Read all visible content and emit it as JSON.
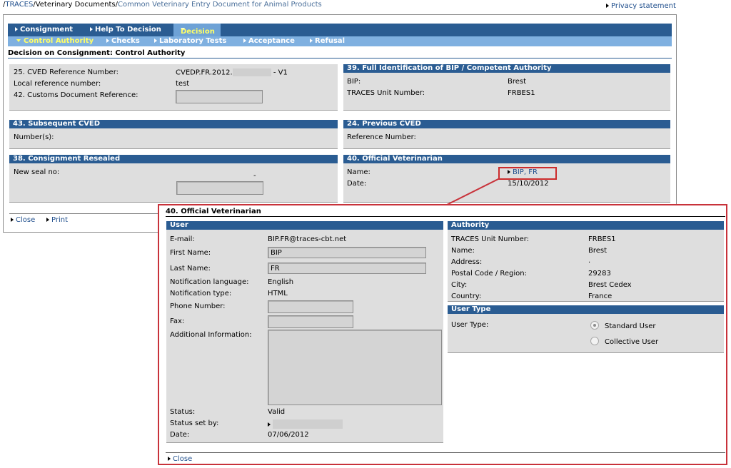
{
  "breadcrumb": {
    "sep": "/",
    "traces": "TRACES",
    "vet_docs": "Veterinary Documents",
    "current": "Common Veterinary Entry Document for Animal Products"
  },
  "privacy": "Privacy statement",
  "nav": {
    "top": [
      "Consignment",
      "Help To Decision",
      "Decision"
    ],
    "sub": [
      "Control Authority",
      "Checks",
      "Laboratory Tests",
      "Acceptance",
      "Refusal"
    ]
  },
  "page_title": "Decision on Consignment: Control Authority",
  "cved": {
    "ref_label": "25. CVED Reference Number:",
    "ref_prefix": "CVEDP.FR.2012.",
    "ref_suffix": "- V1",
    "local_label": "Local reference number:",
    "local_value": "test",
    "customs_label": "42. Customs Document Reference:",
    "customs_value": ""
  },
  "bip_panel": {
    "header": "39. Full Identification of BIP / Competent Authority",
    "bip_label": "BIP:",
    "bip_value": "Brest",
    "unit_label": "TRACES Unit Number:",
    "unit_value": "FRBES1"
  },
  "subsequent": {
    "header": "43. Subsequent CVED",
    "label": "Number(s):"
  },
  "previous": {
    "header": "24. Previous CVED",
    "label": "Reference Number:"
  },
  "resealed": {
    "header": "38. Consignment Resealed",
    "label": "New seal no:",
    "dash": "-"
  },
  "official_vet": {
    "header": "40. Official Veterinarian",
    "name_label": "Name:",
    "name_value": "BIP, FR",
    "date_label": "Date:",
    "date_value": "15/10/2012"
  },
  "actions": {
    "close": "Close",
    "print": "Print"
  },
  "popup": {
    "title": "40. Official Veterinarian",
    "user": {
      "header": "User",
      "email_label": "E-mail:",
      "email_value": "BIP.FR@traces-cbt.net",
      "first_label": "First Name:",
      "first_value": "BIP",
      "last_label": "Last Name:",
      "last_value": "FR",
      "lang_label": "Notification language:",
      "lang_value": "English",
      "type_label": "Notification type:",
      "type_value": "HTML",
      "phone_label": "Phone Number:",
      "phone_value": "",
      "fax_label": "Fax:",
      "fax_value": "",
      "info_label": "Additional Information:",
      "info_value": "",
      "status_label": "Status:",
      "status_value": "Valid",
      "set_by_label": "Status set by:",
      "date_label": "Date:",
      "date_value": "07/06/2012"
    },
    "authority": {
      "header": "Authority",
      "unit_label": "TRACES Unit Number:",
      "unit_value": "FRBES1",
      "name_label": "Name:",
      "name_value": "Brest",
      "address_label": "Address:",
      "address_value": ".",
      "postal_label": "Postal Code / Region:",
      "postal_value": "29283",
      "city_label": "City:",
      "city_value": "Brest Cedex",
      "country_label": "Country:",
      "country_value": "France"
    },
    "user_type": {
      "header": "User Type",
      "label": "User Type:",
      "options": [
        "Standard User",
        "Collective User"
      ],
      "selected": "Standard User"
    },
    "close": "Close"
  },
  "colors": {
    "header_blue": "#2a5c92",
    "subnav_blue": "#7fb0e0",
    "active_yellow": "#ffff66",
    "highlight_red": "#c8323a",
    "panel_gray": "#dedede"
  }
}
